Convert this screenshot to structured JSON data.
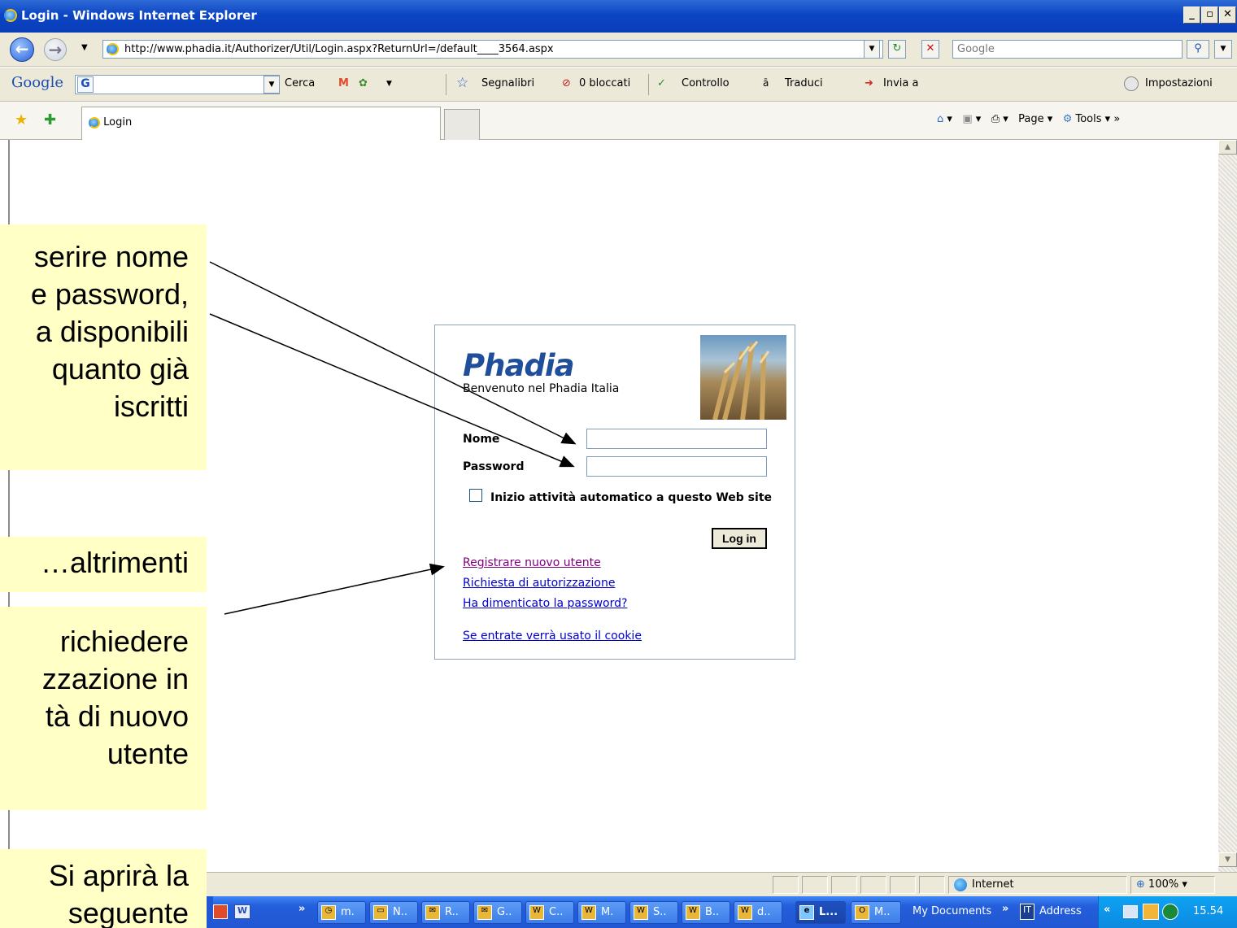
{
  "window": {
    "title": "Login - Windows Internet Explorer"
  },
  "addressbar": {
    "url": "http://www.phadia.it/Authorizer/Util/Login.aspx?ReturnUrl=/default____3564.aspx",
    "search_placeholder": "Google"
  },
  "googlebar": {
    "logo": "Google",
    "search_label": "Cerca",
    "bookmarks": "Segnalibri",
    "blocked": "0 bloccati",
    "check": "Controllo",
    "translate": "Traduci",
    "send": "Invia a",
    "settings": "Impostazioni"
  },
  "tabbar": {
    "tab_label": "Login",
    "page_menu": "Page",
    "tools_menu": "Tools"
  },
  "login": {
    "brand": "Phadia",
    "welcome": "Benvenuto nel Phadia Italia",
    "name_label": "Nome",
    "password_label": "Password",
    "remember_label": "Inizio attività automatico a questo Web site",
    "login_button": "Log in",
    "links": {
      "register": "Registrare nuovo utente",
      "authorization": "Richiesta di autorizzazione",
      "forgot": "Ha dimenticato la password?",
      "cookie": "Se entrate verrà usato il cookie"
    }
  },
  "notes": {
    "note1": [
      "serire nome",
      "e password,",
      "a disponibili",
      "quanto già",
      "iscritti"
    ],
    "note2": [
      "…altrimenti"
    ],
    "note3": [
      "richiedere",
      "zzazione in",
      "tà di nuovo",
      "utente"
    ],
    "note4": [
      "Si aprirà la",
      "seguente"
    ]
  },
  "statusbar": {
    "zone": "Internet",
    "zoom": "100%"
  },
  "taskbar": {
    "buttons": [
      "m.",
      "N..",
      "R..",
      "G..",
      "C..",
      "M.",
      "S..",
      "B..",
      "d..",
      "L...",
      "M.."
    ],
    "docs": "My Documents",
    "address": "Address",
    "clock": "15.54"
  }
}
